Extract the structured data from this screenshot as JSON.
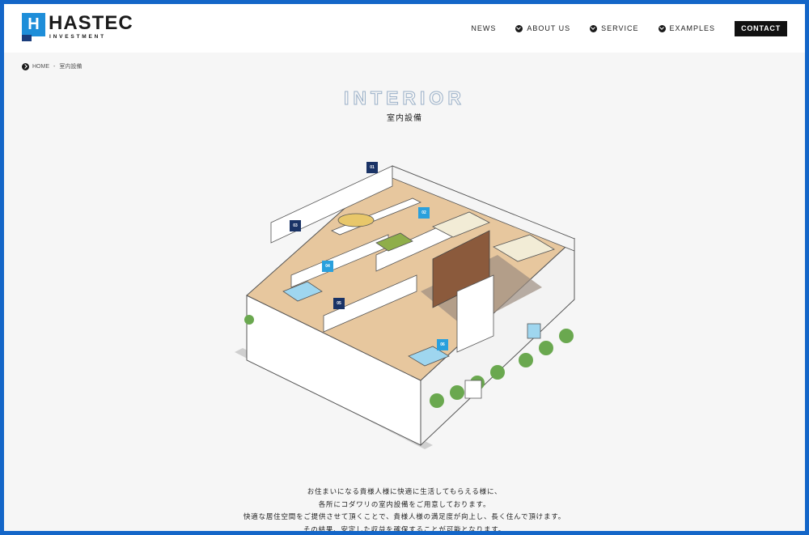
{
  "header": {
    "logo_letter": "H",
    "logo_name": "HASTEC",
    "logo_sub": "INVESTMENT",
    "nav": {
      "news": "NEWS",
      "about": "ABOUT US",
      "service": "SERVICE",
      "examples": "EXAMPLES",
      "contact": "CONTACT"
    }
  },
  "breadcrumb": {
    "home": "HOME",
    "separator": "-",
    "current": "室内設備"
  },
  "page": {
    "title_en": "INTERIOR",
    "title_ja": "室内設備"
  },
  "markers": [
    "01",
    "02",
    "03",
    "04",
    "05",
    "06"
  ],
  "description": [
    "お住まいになる貴様人様に快適に生活してもらえる様に、",
    "各所にコダワリの室内設備をご用意しております。",
    "快適な居住空間をご提供させて頂くことで、貴様人様の満足度が向上し、長く住んで頂けます。",
    "その結果、安定した収益を確保することが可能となります。"
  ],
  "colors": {
    "frame": "#1466c8",
    "accent_blue": "#1e8ed9",
    "navy": "#1a3366",
    "light_blue": "#2aa0dd"
  }
}
